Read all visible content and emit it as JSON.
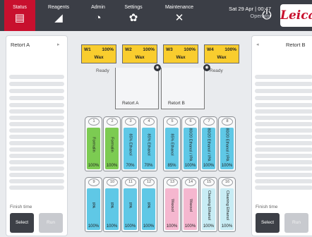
{
  "tabs": [
    {
      "label": "Status",
      "icon": "status-icon",
      "glyph": "▤"
    },
    {
      "label": "Reagents",
      "icon": "reagent-bottle-icon",
      "glyph": "◢"
    },
    {
      "label": "Admin",
      "icon": "admin-icon",
      "glyph": "◔"
    },
    {
      "label": "Settings",
      "icon": "settings-gear-icon",
      "glyph": "✿"
    },
    {
      "label": "Maintenance",
      "icon": "maintenance-tools-icon",
      "glyph": "✕"
    }
  ],
  "datetime": "Sat 29 Apr | 00:47",
  "operator": "Operator",
  "logo": "Leica",
  "retortA": {
    "title": "Retort A",
    "finish_time": "Finish time",
    "select": "Select",
    "run": "Run",
    "arrow": "▸"
  },
  "retortB": {
    "title": "Retort B",
    "finish_time": "Finish time",
    "select": "Select",
    "run": "Run",
    "arrow": "◂"
  },
  "wax": [
    {
      "name": "W1",
      "pct": "100%",
      "label": "Wax"
    },
    {
      "name": "W2",
      "pct": "100%",
      "label": "Wax"
    },
    {
      "name": "W3",
      "pct": "100%",
      "label": "Wax"
    },
    {
      "name": "W4",
      "pct": "100%",
      "label": "Wax"
    }
  ],
  "retort_center": {
    "a_label": "Retort A",
    "b_label": "Retort B",
    "a_status": "Ready",
    "b_status": "Ready"
  },
  "colors": {
    "green": "#7ccb52",
    "blue": "#5fc8e6",
    "pink": "#f5b7cf",
    "lightblue": "#c8ecf4",
    "wax": "#f9cd2e",
    "accent": "#c8102e"
  },
  "bottles_row1": [
    {
      "num": "1",
      "reagent": "Formalin",
      "pct": "100%",
      "color": "green"
    },
    {
      "num": "2",
      "reagent": "Formalin",
      "pct": "100%",
      "color": "green"
    },
    {
      "num": "3",
      "reagent": "85% Ethanol",
      "pct": "70%",
      "color": "blue"
    },
    {
      "num": "4",
      "reagent": "85% Ethanol",
      "pct": "70%",
      "color": "blue"
    },
    {
      "num": "5",
      "reagent": "85% Ethanol",
      "pct": "85%",
      "color": "blue"
    },
    {
      "num": "6",
      "reagent": "80/20 Ethanol / IPA",
      "pct": "100%",
      "color": "blue"
    },
    {
      "num": "7",
      "reagent": "80/20 Ethanol / IPA",
      "pct": "100%",
      "color": "blue"
    },
    {
      "num": "8",
      "reagent": "80/20 Ethanol / IPA",
      "pct": "100%",
      "color": "blue"
    }
  ],
  "bottles_row2": [
    {
      "num": "9",
      "reagent": "IPA",
      "pct": "100%",
      "color": "blue"
    },
    {
      "num": "10",
      "reagent": "IPA",
      "pct": "100%",
      "color": "blue"
    },
    {
      "num": "11",
      "reagent": "IPA",
      "pct": "100%",
      "color": "blue"
    },
    {
      "num": "12",
      "reagent": "IPA",
      "pct": "100%",
      "color": "blue"
    },
    {
      "num": "13",
      "reagent": "Waxsol",
      "pct": "100%",
      "color": "pink"
    },
    {
      "num": "14",
      "reagent": "Waxsol",
      "pct": "100%",
      "color": "pink"
    },
    {
      "num": "15",
      "reagent": "Cleaning Ethanol",
      "pct": "100%",
      "color": "lightblue"
    },
    {
      "num": "16",
      "reagent": "Cleaning Ethanol",
      "pct": "100%",
      "color": "lightblue"
    }
  ]
}
